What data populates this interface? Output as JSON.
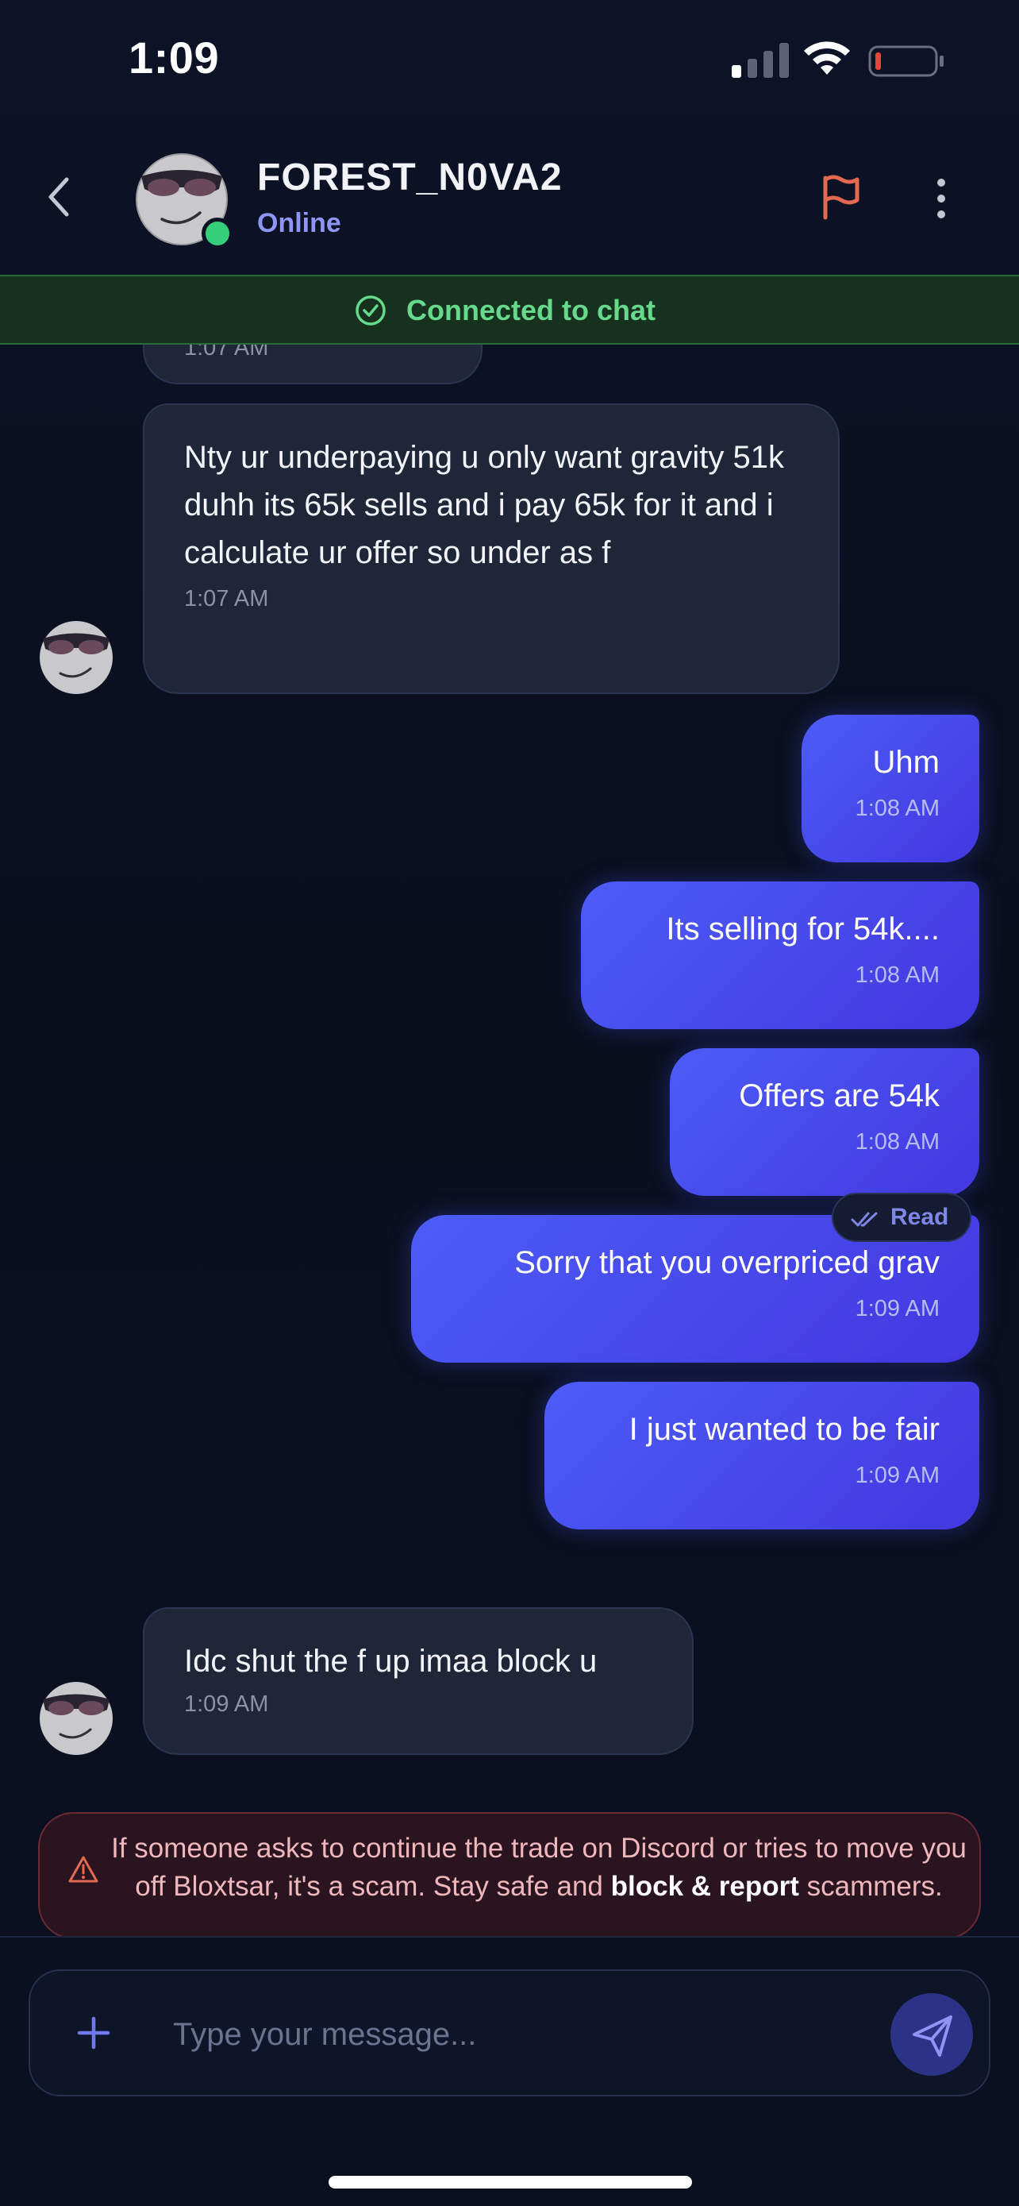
{
  "status_bar": {
    "time": "1:09"
  },
  "header": {
    "contact_name": "FOREST_N0VA2",
    "contact_status": "Online",
    "icons": {
      "back": "chevron-left-icon",
      "report": "flag-icon",
      "menu": "more-vertical-icon"
    },
    "colors": {
      "status": "#8f95f5",
      "online_dot": "#34d07a",
      "flag": "#e36a50"
    }
  },
  "connection_banner": {
    "text": "Connected to chat",
    "color": "#67d98c"
  },
  "messages": [
    {
      "from": "contact",
      "text": "1:07 AM",
      "partial": true
    },
    {
      "from": "contact",
      "text": "Nty ur underpaying u only want gravity  51k duhh its 65k sells and i pay 65k for it and i calculate ur offer so under as f",
      "time": "1:07 AM"
    },
    {
      "from": "me",
      "text": "Uhm",
      "time": "1:08 AM"
    },
    {
      "from": "me",
      "text": "Its selling for 54k....",
      "time": "1:08 AM"
    },
    {
      "from": "me",
      "text": "Offers are 54k",
      "time": "1:08 AM"
    },
    {
      "from": "me",
      "text": "Sorry that you overpriced grav",
      "time": "1:09 AM"
    },
    {
      "from": "me",
      "text": "I just wanted to be fair",
      "time": "1:09 AM"
    },
    {
      "from": "contact",
      "text": "Idc shut the f up imaa block u",
      "time": "1:09 AM"
    }
  ],
  "read_receipt": {
    "label": "Read"
  },
  "warning": {
    "text_before": "If someone asks to continue the trade on Discord or tries to move you off Bloxtsar, it's a scam. Stay safe and ",
    "bold": "block & report",
    "text_after": " scammers."
  },
  "composer": {
    "placeholder": "Type your message...",
    "value": ""
  },
  "theme": {
    "accent": "#4c5cf7",
    "background": "#0b1020",
    "incoming_bubble": "#1f2638"
  }
}
